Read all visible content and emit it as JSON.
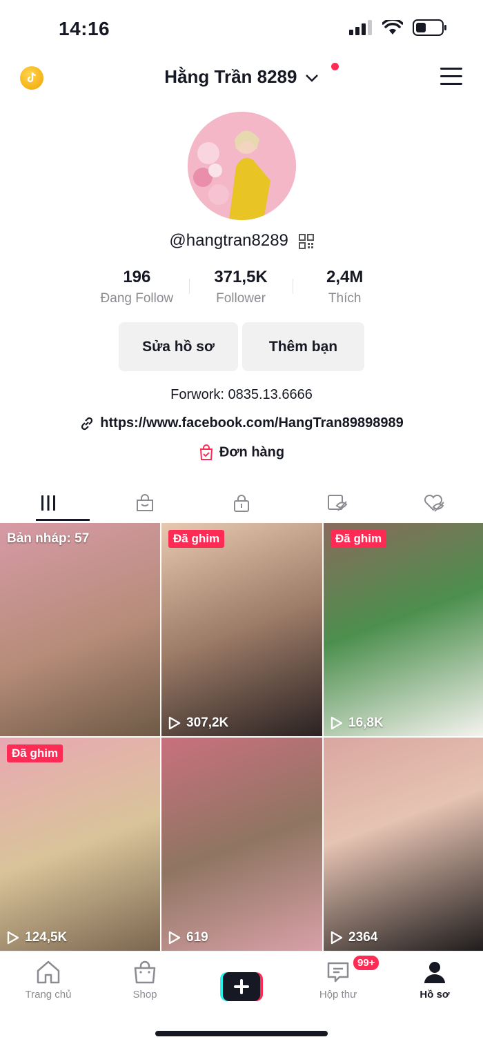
{
  "status": {
    "time": "14:16"
  },
  "header": {
    "title": "Hằng Trần 8289"
  },
  "profile": {
    "username": "@hangtran8289",
    "stats": [
      {
        "value": "196",
        "label": "Đang Follow"
      },
      {
        "value": "371,5K",
        "label": "Follower"
      },
      {
        "value": "2,4M",
        "label": "Thích"
      }
    ],
    "edit_label": "Sửa hồ sơ",
    "add_friend_label": "Thêm bạn",
    "bio": "Forwork: 0835.13.6666",
    "link": "https://www.facebook.com/HangTran89898989",
    "orders_label": "Đơn hàng"
  },
  "tabs": [
    {
      "icon": "videos-grid-icon"
    },
    {
      "icon": "shop-bag-icon"
    },
    {
      "icon": "private-lock-icon"
    },
    {
      "icon": "reposts-icon"
    },
    {
      "icon": "liked-hidden-icon"
    }
  ],
  "videos": [
    {
      "overlay": "Bản nháp: 57",
      "views": "",
      "pinned": "",
      "bg": "#b58a8a"
    },
    {
      "overlay": "",
      "views": "307,2K",
      "pinned": "Đã ghim",
      "bg": "#8c6f62"
    },
    {
      "overlay": "",
      "views": "16,8K",
      "pinned": "Đã ghim",
      "bg": "#6e8a73"
    },
    {
      "overlay": "",
      "views": "124,5K",
      "pinned": "Đã ghim",
      "bg": "#c89aa5"
    },
    {
      "overlay": "",
      "views": "619",
      "pinned": "",
      "bg": "#9a7d6a"
    },
    {
      "overlay": "",
      "views": "2364",
      "pinned": "",
      "bg": "#5a4a48"
    }
  ],
  "nav": {
    "home": "Trang chủ",
    "shop": "Shop",
    "inbox": "Hộp thư",
    "inbox_badge": "99+",
    "profile": "Hồ sơ"
  },
  "colors": {
    "accent": "#fe2c55",
    "text": "#161823",
    "muted": "#8a8b91"
  }
}
